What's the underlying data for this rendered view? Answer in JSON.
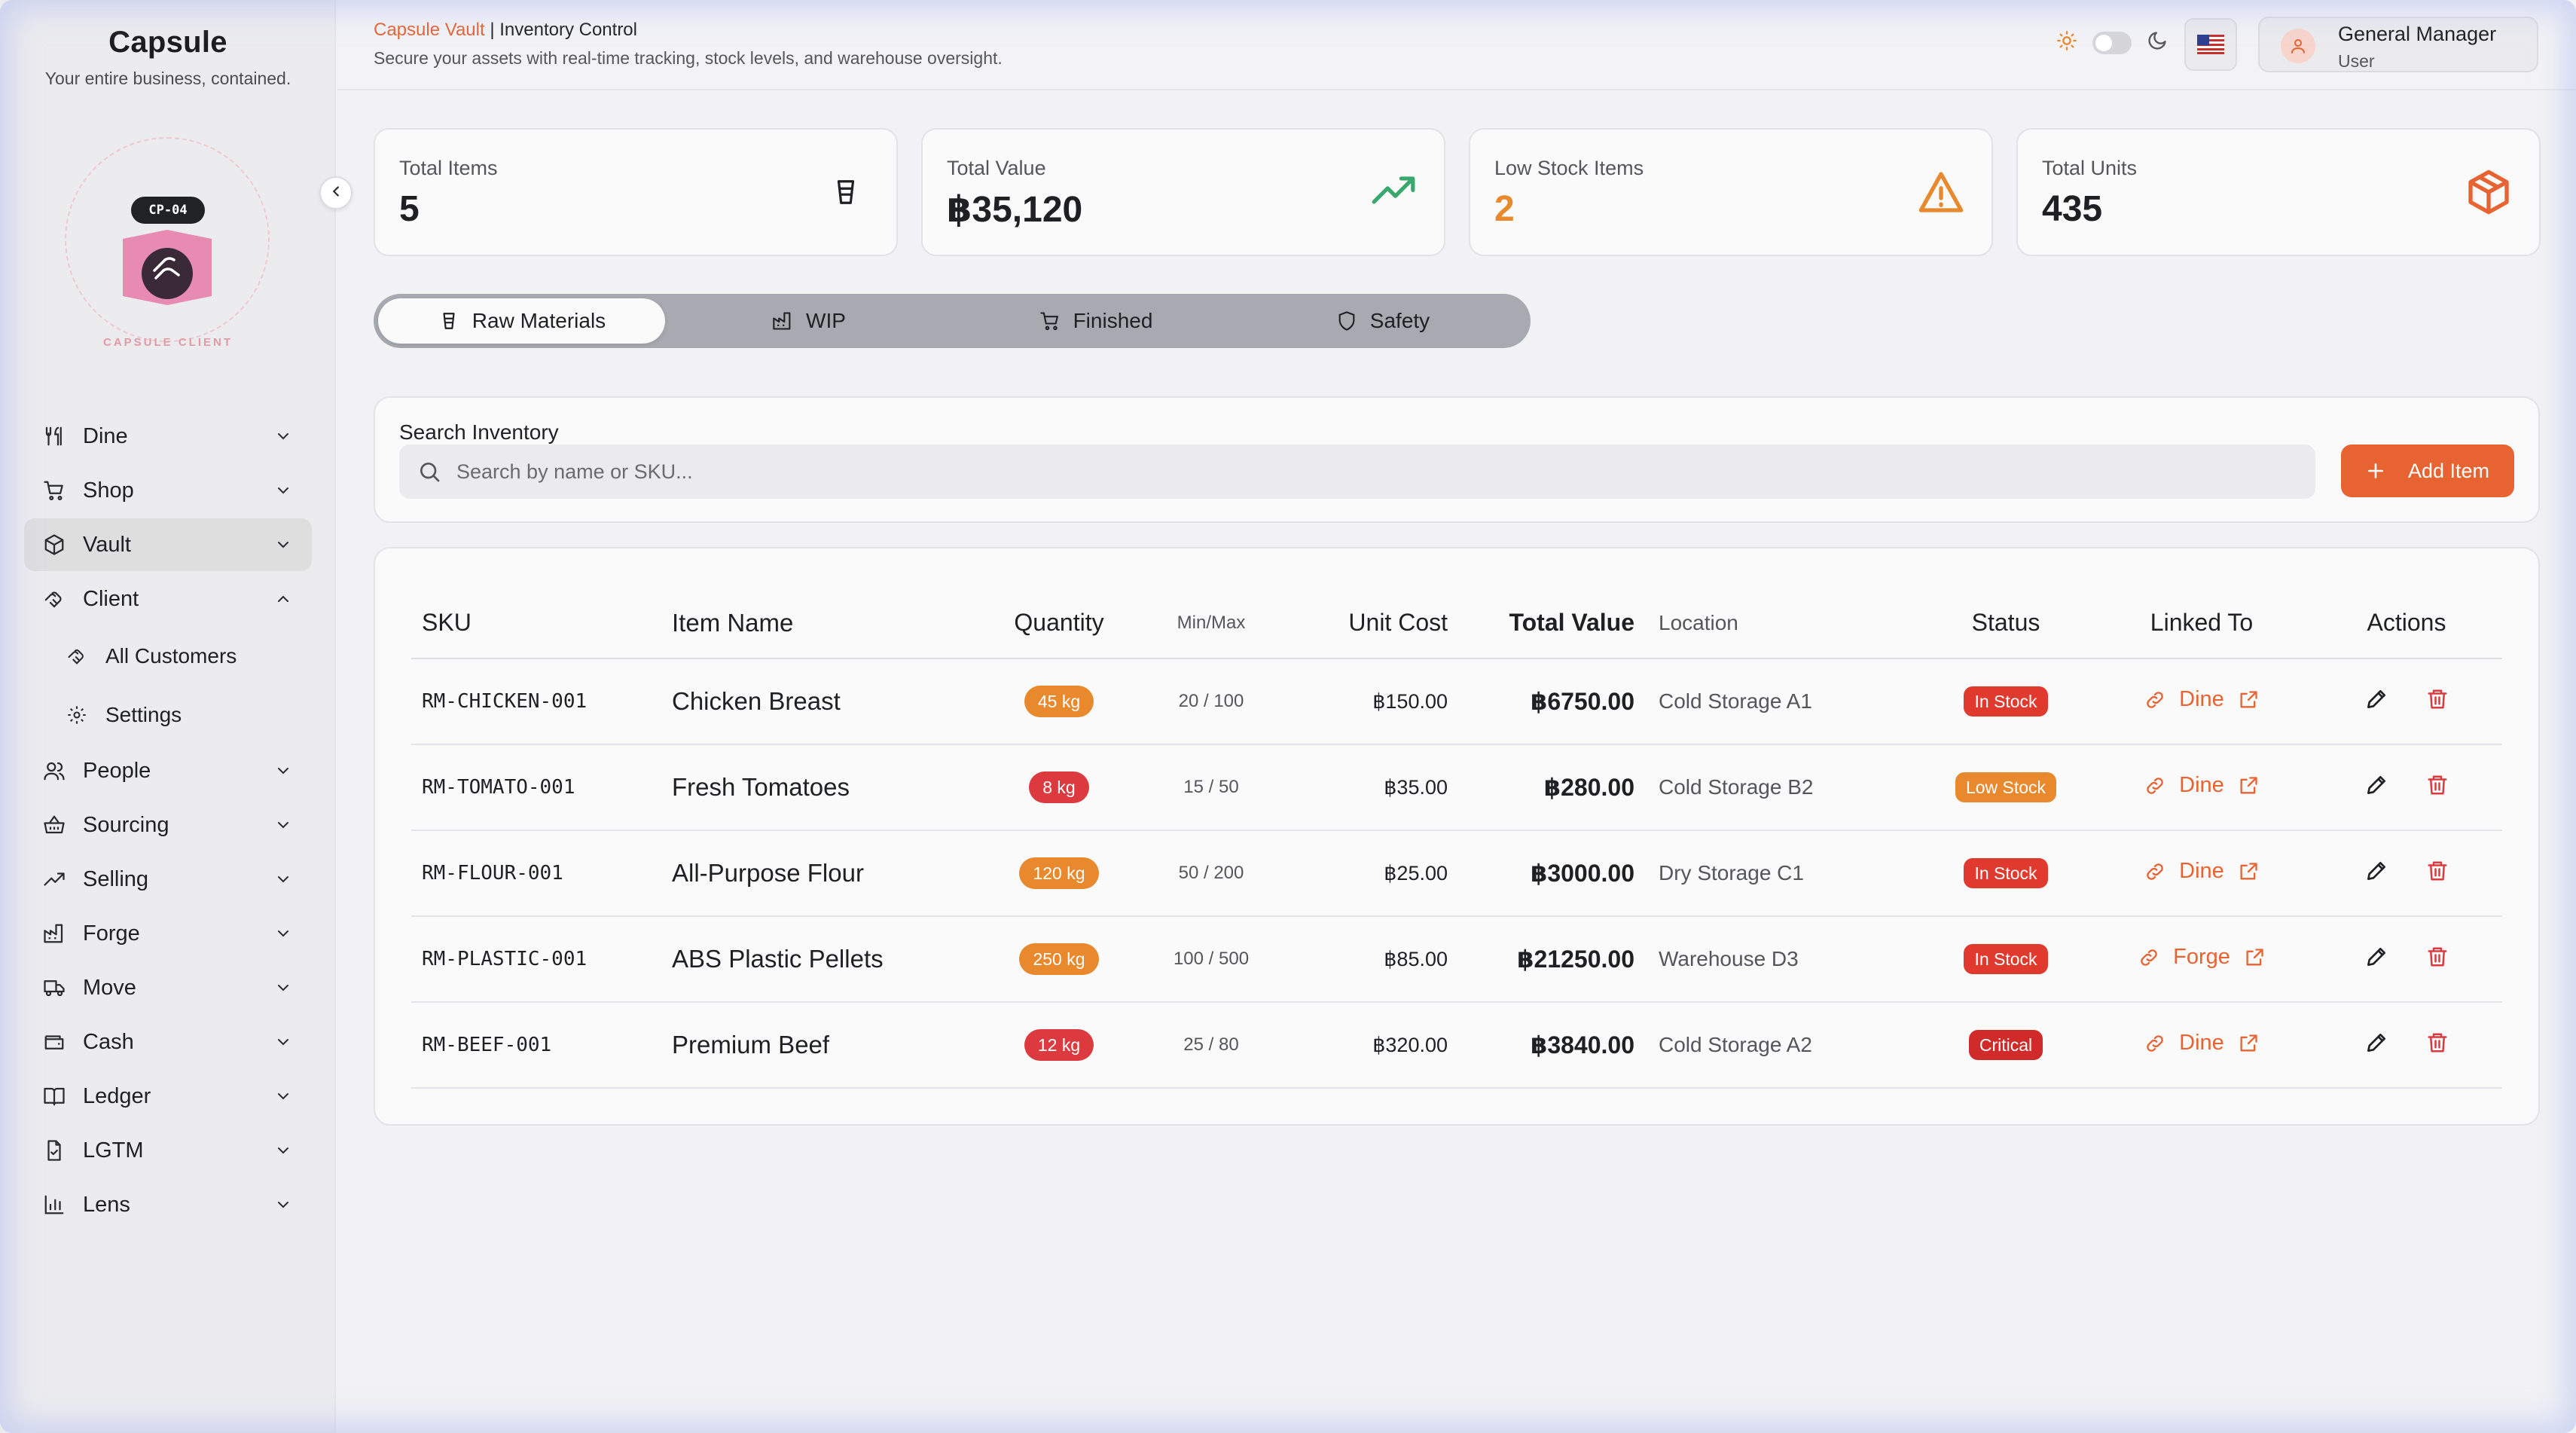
{
  "brand": {
    "name": "Capsule",
    "tagline": "Your entire business, contained."
  },
  "client": {
    "code": "CP-04",
    "label": "CAPSULE CLIENT"
  },
  "nav": {
    "items": [
      {
        "label": "Dine",
        "icon": "utensils-icon"
      },
      {
        "label": "Shop",
        "icon": "cart-icon"
      },
      {
        "label": "Vault",
        "icon": "box-icon",
        "active": true
      },
      {
        "label": "Client",
        "icon": "handshake-icon",
        "expanded": true
      },
      {
        "label": "People",
        "icon": "people-icon"
      },
      {
        "label": "Sourcing",
        "icon": "basket-icon"
      },
      {
        "label": "Selling",
        "icon": "trend-icon"
      },
      {
        "label": "Forge",
        "icon": "factory-icon"
      },
      {
        "label": "Move",
        "icon": "truck-icon"
      },
      {
        "label": "Cash",
        "icon": "wallet-icon"
      },
      {
        "label": "Ledger",
        "icon": "book-icon"
      },
      {
        "label": "LGTM",
        "icon": "file-check-icon"
      },
      {
        "label": "Lens",
        "icon": "bar-chart-icon"
      }
    ],
    "client_sub": [
      {
        "label": "All Customers",
        "icon": "handshake-icon"
      },
      {
        "label": "Settings",
        "icon": "gear-icon"
      }
    ]
  },
  "header": {
    "app": "Capsule Vault",
    "separator": " | ",
    "section": "Inventory Control",
    "subtitle": "Secure your assets with real-time tracking, stock levels, and warehouse oversight.",
    "user_name": "General Manager",
    "user_role": "User"
  },
  "stats": [
    {
      "title": "Total Items",
      "value": "5",
      "icon": "cup-icon"
    },
    {
      "title": "Total Value",
      "value": "฿35,120",
      "icon": "trending-up-icon"
    },
    {
      "title": "Low Stock Items",
      "value": "2",
      "icon": "warning-icon"
    },
    {
      "title": "Total Units",
      "value": "435",
      "icon": "package-icon"
    }
  ],
  "tabs": [
    {
      "label": "Raw Materials",
      "icon": "cup-icon",
      "active": true
    },
    {
      "label": "WIP",
      "icon": "factory-icon"
    },
    {
      "label": "Finished",
      "icon": "cart-icon"
    },
    {
      "label": "Safety",
      "icon": "shield-icon"
    }
  ],
  "search": {
    "label": "Search Inventory",
    "placeholder": "Search by name or SKU...",
    "value": "",
    "add_label": "Add Item"
  },
  "table": {
    "headers": [
      "SKU",
      "Item Name",
      "Quantity",
      "Min/Max",
      "Unit Cost",
      "Total Value",
      "Location",
      "Status",
      "Linked To",
      "Actions"
    ],
    "rows": [
      {
        "sku": "RM-CHICKEN-001",
        "name": "Chicken Breast",
        "qty": "45 kg",
        "minmax": "20 / 100",
        "unit_cost": "฿150.00",
        "total": "฿6750.00",
        "location": "Cold Storage A1",
        "status": "In Stock",
        "linked": "Dine"
      },
      {
        "sku": "RM-TOMATO-001",
        "name": "Fresh Tomatoes",
        "qty": "8 kg",
        "minmax": "15 / 50",
        "unit_cost": "฿35.00",
        "total": "฿280.00",
        "location": "Cold Storage B2",
        "status": "Low Stock",
        "linked": "Dine"
      },
      {
        "sku": "RM-FLOUR-001",
        "name": "All-Purpose Flour",
        "qty": "120 kg",
        "minmax": "50 / 200",
        "unit_cost": "฿25.00",
        "total": "฿3000.00",
        "location": "Dry Storage C1",
        "status": "In Stock",
        "linked": "Dine"
      },
      {
        "sku": "RM-PLASTIC-001",
        "name": "ABS Plastic Pellets",
        "qty": "250 kg",
        "minmax": "100 / 500",
        "unit_cost": "฿85.00",
        "total": "฿21250.00",
        "location": "Warehouse D3",
        "status": "In Stock",
        "linked": "Forge"
      },
      {
        "sku": "RM-BEEF-001",
        "name": "Premium Beef",
        "qty": "12 kg",
        "minmax": "25 / 80",
        "unit_cost": "฿320.00",
        "total": "฿3840.00",
        "location": "Cold Storage A2",
        "status": "Critical",
        "linked": "Dine"
      }
    ]
  },
  "colors": {
    "accent": "#e86332",
    "warning": "#e8892e",
    "danger": "#dc3a3e",
    "success": "#3aa76d"
  }
}
